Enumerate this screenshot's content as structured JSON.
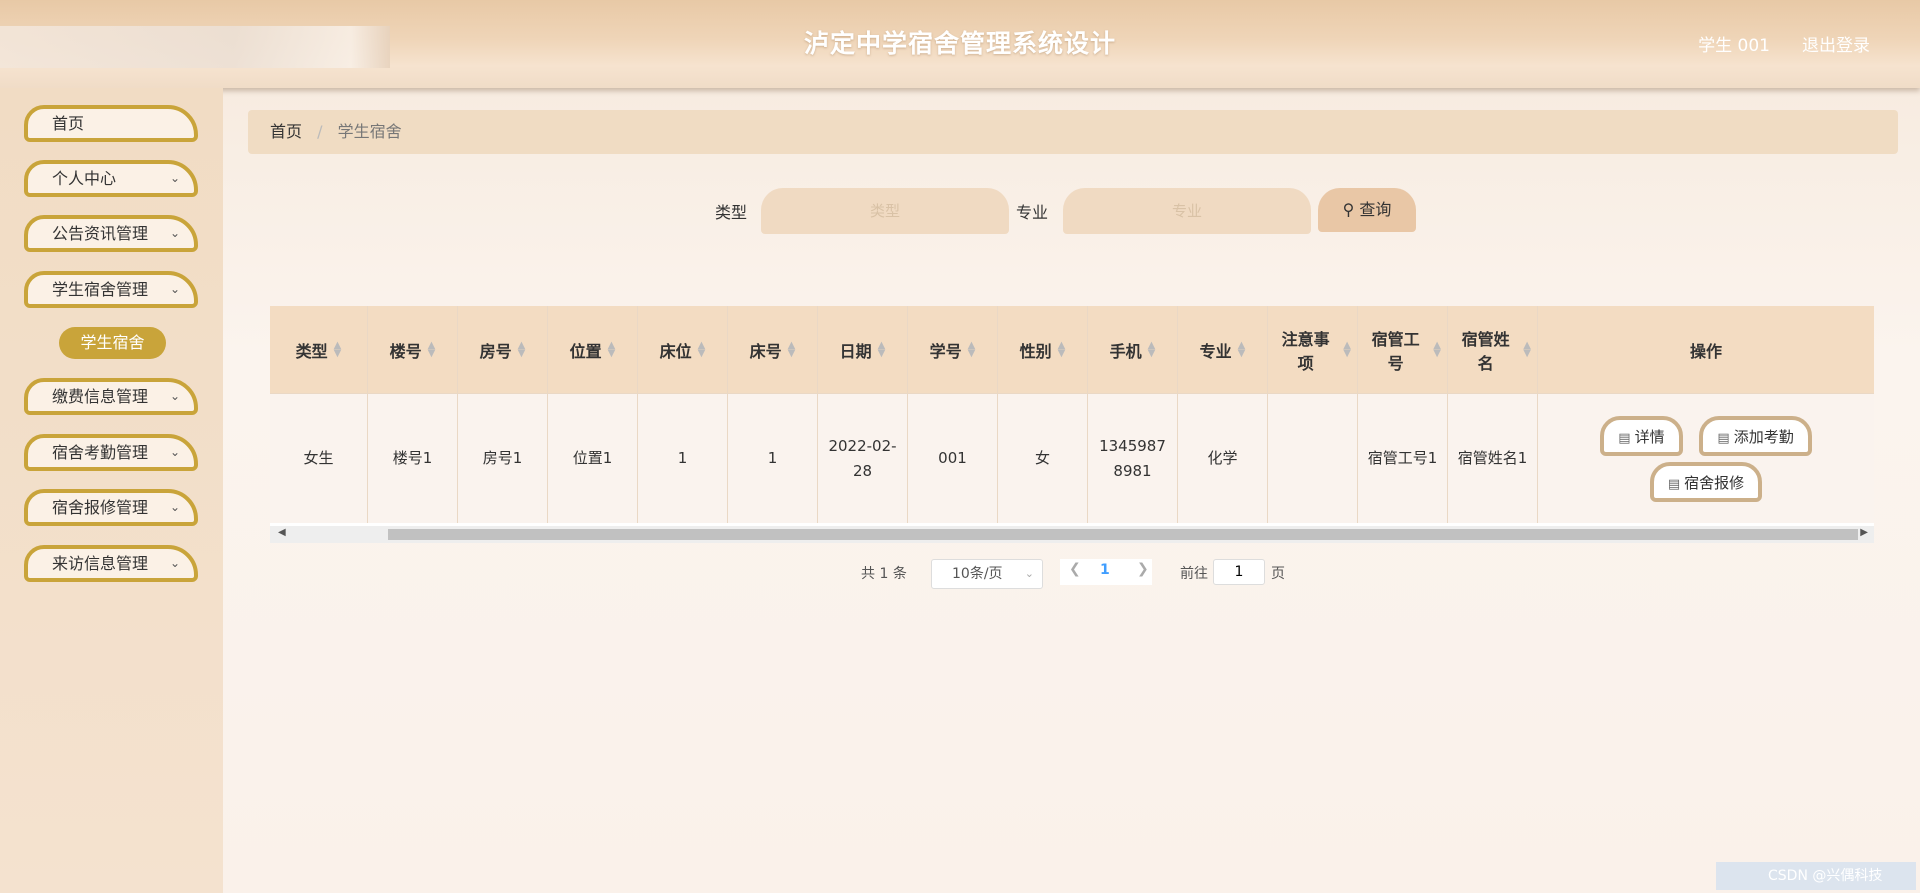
{
  "header": {
    "title": "泸定中学宿舍管理系统设计",
    "user": "学生 001",
    "logout": "退出登录"
  },
  "sidebar": {
    "items": [
      {
        "label": "首页",
        "has_children": false
      },
      {
        "label": "个人中心",
        "has_children": true
      },
      {
        "label": "公告资讯管理",
        "has_children": true
      },
      {
        "label": "学生宿舍管理",
        "has_children": true
      },
      {
        "label": "缴费信息管理",
        "has_children": true
      },
      {
        "label": "宿舍考勤管理",
        "has_children": true
      },
      {
        "label": "宿舍报修管理",
        "has_children": true
      },
      {
        "label": "来访信息管理",
        "has_children": true
      }
    ],
    "active_sub": "学生宿舍"
  },
  "breadcrumb": {
    "home": "首页",
    "separator": "/",
    "current": "学生宿舍"
  },
  "search": {
    "type_label": "类型",
    "type_placeholder": "类型",
    "major_label": "专业",
    "major_placeholder": "专业",
    "query_button": "查询"
  },
  "table": {
    "columns": [
      {
        "label": "类型",
        "sortable": true
      },
      {
        "label": "楼号",
        "sortable": true
      },
      {
        "label": "房号",
        "sortable": true
      },
      {
        "label": "位置",
        "sortable": true
      },
      {
        "label": "床位",
        "sortable": true
      },
      {
        "label": "床号",
        "sortable": true
      },
      {
        "label": "日期",
        "sortable": true
      },
      {
        "label": "学号",
        "sortable": true
      },
      {
        "label": "性别",
        "sortable": true
      },
      {
        "label": "手机",
        "sortable": true
      },
      {
        "label": "专业",
        "sortable": true
      },
      {
        "label": "注意事项",
        "sortable": true
      },
      {
        "label": "宿管工号",
        "sortable": true
      },
      {
        "label": "宿管姓名",
        "sortable": true
      },
      {
        "label": "操作",
        "sortable": false
      }
    ],
    "rows": [
      {
        "cells": [
          "女生",
          "楼号1",
          "房号1",
          "位置1",
          "1",
          "1",
          "2022-02-28",
          "001",
          "女",
          "13459878981",
          "化学",
          "",
          "宿管工号1",
          "宿管姓名1"
        ],
        "actions": [
          "详情",
          "添加考勤",
          "宿舍报修"
        ]
      }
    ]
  },
  "pagination": {
    "total_prefix": "共",
    "total": "1",
    "total_suffix": "条",
    "page_size": "10条/页",
    "current_page": "1",
    "goto_label": "前往",
    "goto_value": "1",
    "goto_suffix": "页"
  },
  "watermark": "CSDN @兴偶科技",
  "colors": {
    "accent": "#c9a43a",
    "header": "#e8c9a6",
    "table_header": "#f3dcc2",
    "active_page": "#409eff"
  }
}
